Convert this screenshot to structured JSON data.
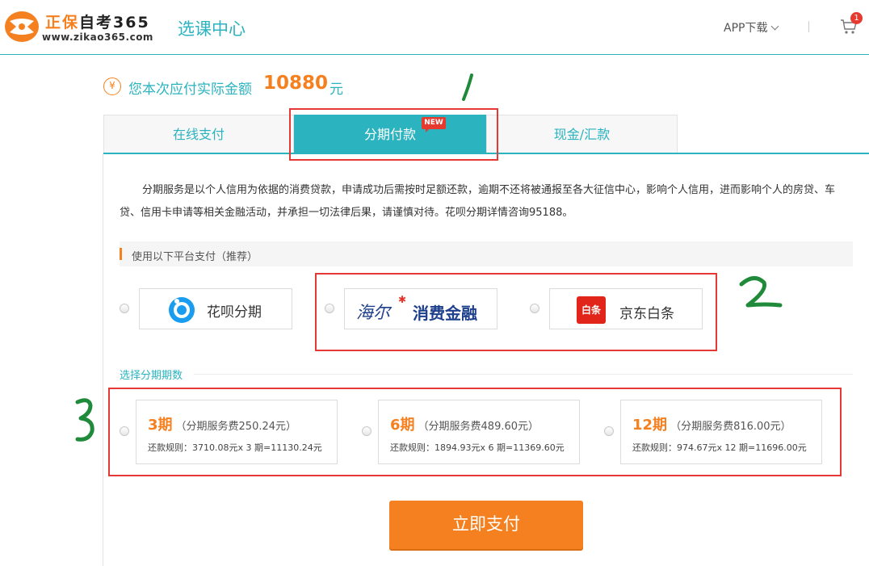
{
  "header": {
    "logo_cn_part1": "正保",
    "logo_cn_part2": "自考365",
    "logo_url": "www.zikao365.com",
    "page_title": "选课中心",
    "app_download": "APP下载",
    "cart_count": "1"
  },
  "amount": {
    "currency_icon": "¥",
    "label": "您本次应付实际金额",
    "value": "10880",
    "unit": "元"
  },
  "tabs": [
    {
      "label": "在线支付",
      "active": false
    },
    {
      "label": "分期付款",
      "active": true,
      "badge": "NEW"
    },
    {
      "label": "现金/汇款",
      "active": false
    }
  ],
  "description": "分期服务是以个人信用为依据的消费贷款，申请成功后需按时足额还款，逾期不还将被通报至各大征信中心，影响个人信用，进而影响个人的房贷、车贷、信用卡申请等相关金融活动，并承担一切法律后果，请谨慎对待。花呗分期详情咨询95188。",
  "platform": {
    "heading": "使用以下平台支付（推荐）",
    "options": [
      {
        "name": "花呗分期",
        "icon": "huabei-icon"
      },
      {
        "name": "海尔消费金融",
        "logo_text_1": "海尔",
        "logo_text_2": "消费金融",
        "icon": "haier-logo"
      },
      {
        "name": "京东白条",
        "icon_text": "白条",
        "icon": "jd-baitiao-icon"
      }
    ]
  },
  "periods": {
    "heading": "选择分期期数",
    "plans": [
      {
        "name": "3期",
        "fee": "（分期服务费250.24元）",
        "rule": "还款规则：3710.08元x 3 期=11130.24元"
      },
      {
        "name": "6期",
        "fee": "（分期服务费489.60元）",
        "rule": "还款规则：1894.93元x 6 期=11369.60元"
      },
      {
        "name": "12期",
        "fee": "（分期服务费816.00元）",
        "rule": "还款规则：974.67元x 12 期=11696.00元"
      }
    ]
  },
  "pay_button": "立即支付",
  "colors": {
    "teal": "#2bb3bf",
    "orange": "#f5801f",
    "red_annotation": "#e53935",
    "green_annotation": "#1f8a3a"
  }
}
